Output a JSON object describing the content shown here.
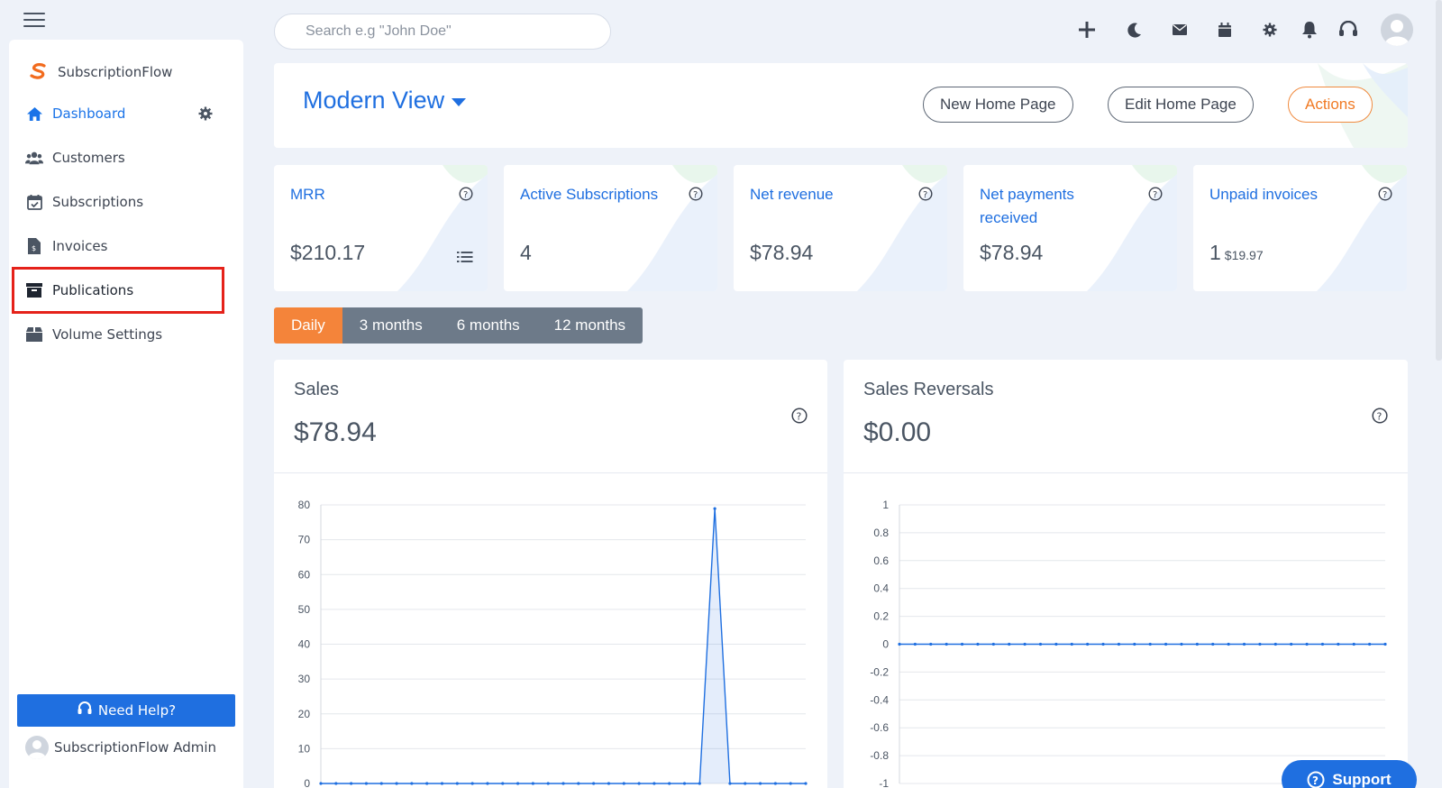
{
  "app": {
    "brand_name": "SubscriptionFlow",
    "accent_color": "#1f6fe0",
    "highlight_color": "#e5221a"
  },
  "sidebar": {
    "items": [
      {
        "label": "Dashboard",
        "icon": "home-icon",
        "active": true
      },
      {
        "label": "Customers",
        "icon": "users-icon",
        "active": false
      },
      {
        "label": "Subscriptions",
        "icon": "calendar-check-icon",
        "active": false
      },
      {
        "label": "Invoices",
        "icon": "invoice-icon",
        "active": false
      },
      {
        "label": "Publications",
        "icon": "archive-icon",
        "active": false,
        "highlighted": true
      },
      {
        "label": "Volume Settings",
        "icon": "box-icon",
        "active": false
      }
    ],
    "help_label": "Need Help?",
    "admin_name": "SubscriptionFlow Admin"
  },
  "topbar": {
    "search_placeholder": "Search e.g \"John Doe\"",
    "icons": [
      "plus-icon",
      "moon-icon",
      "mail-icon",
      "calendar-icon",
      "gear-icon",
      "bell-icon",
      "headset-icon",
      "avatar"
    ]
  },
  "header": {
    "view_title": "Modern View",
    "buttons": {
      "new_home": "New Home Page",
      "edit_home": "Edit Home Page",
      "actions": "Actions"
    }
  },
  "stats": [
    {
      "title": "MRR",
      "value": "$210.17",
      "sub": ""
    },
    {
      "title": "Active Subscriptions",
      "value": "4",
      "sub": ""
    },
    {
      "title": "Net revenue",
      "value": "$78.94",
      "sub": ""
    },
    {
      "title": "Net payments received",
      "value": "$78.94",
      "sub": ""
    },
    {
      "title": "Unpaid invoices",
      "value": "1",
      "sub": "$19.97"
    }
  ],
  "period_tabs": [
    {
      "label": "Daily",
      "active": true
    },
    {
      "label": "3 months",
      "active": false
    },
    {
      "label": "6 months",
      "active": false
    },
    {
      "label": "12 months",
      "active": false
    }
  ],
  "charts": {
    "sales": {
      "title": "Sales",
      "value": "$78.94"
    },
    "reversals": {
      "title": "Sales Reversals",
      "value": "$0.00"
    }
  },
  "chart_data": [
    {
      "type": "area",
      "title": "Sales",
      "ylim": [
        0,
        80
      ],
      "yticks": [
        "80",
        "70",
        "60",
        "50",
        "40",
        "30",
        "20",
        "10",
        "0"
      ],
      "series": [
        {
          "values": [
            0,
            0,
            0,
            0,
            0,
            0,
            0,
            0,
            0,
            0,
            0,
            0,
            0,
            0,
            0,
            0,
            0,
            0,
            0,
            0,
            0,
            0,
            0,
            0,
            0,
            0,
            78.94,
            0,
            0,
            0,
            0,
            0,
            0
          ]
        }
      ]
    },
    {
      "type": "line",
      "title": "Sales Reversals",
      "ylim": [
        -1,
        1
      ],
      "yticks": [
        "1",
        "0.8",
        "0.6",
        "0.4",
        "0.2",
        "0",
        "-0.2",
        "-0.4",
        "-0.6",
        "-0.8",
        "-1"
      ],
      "series": [
        {
          "values": [
            0,
            0,
            0,
            0,
            0,
            0,
            0,
            0,
            0,
            0,
            0,
            0,
            0,
            0,
            0,
            0,
            0,
            0,
            0,
            0,
            0,
            0,
            0,
            0,
            0,
            0,
            0,
            0,
            0,
            0,
            0,
            0
          ]
        }
      ]
    }
  ],
  "support_label": "Support"
}
